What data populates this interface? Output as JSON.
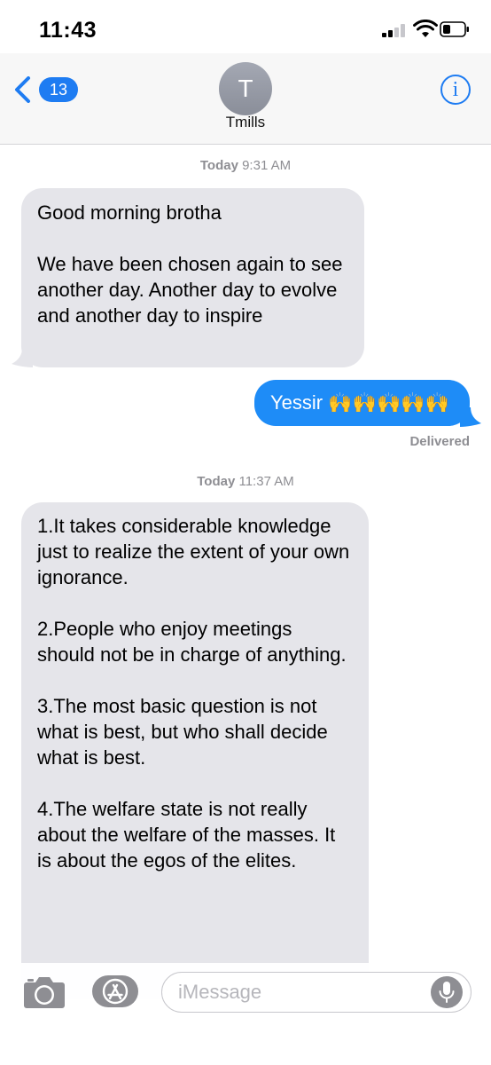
{
  "status_bar": {
    "time": "11:43"
  },
  "header": {
    "back_badge_count": "13",
    "avatar_initial": "T",
    "contact_name": "Tmills",
    "info_label": "i"
  },
  "conversation": {
    "timestamp_1": {
      "day": "Today",
      "time": "9:31 AM"
    },
    "message_1": "Good morning brotha\n\nWe have been chosen again to see another day. Another day to evolve and another day to inspire",
    "message_2": "Yessir 🙌🙌🙌🙌🙌",
    "delivered_label": "Delivered",
    "timestamp_2": {
      "day": "Today",
      "time": "11:37 AM"
    },
    "message_3": "1.It takes considerable knowledge just to realize the extent of your own ignorance.\n\n2.People who enjoy meetings should not be in charge of anything.\n\n3.The most basic question is not what is best, but who shall decide what is best.\n\n4.The welfare state is not really about the welfare of the masses. It is about the egos of the elites."
  },
  "input_bar": {
    "placeholder": "iMessage",
    "value": ""
  },
  "icons": {
    "back": "chevron-left-icon",
    "info": "info-icon",
    "camera": "camera-icon",
    "apps": "app-store-icon",
    "mic": "microphone-icon",
    "signal": "cellular-signal-icon",
    "wifi": "wifi-icon",
    "battery": "battery-icon"
  },
  "colors": {
    "accent": "#1e7cf2",
    "outgoing_bubble": "#1e8cf7",
    "incoming_bubble": "#e5e5ea",
    "secondary_text": "#8e8e93"
  }
}
